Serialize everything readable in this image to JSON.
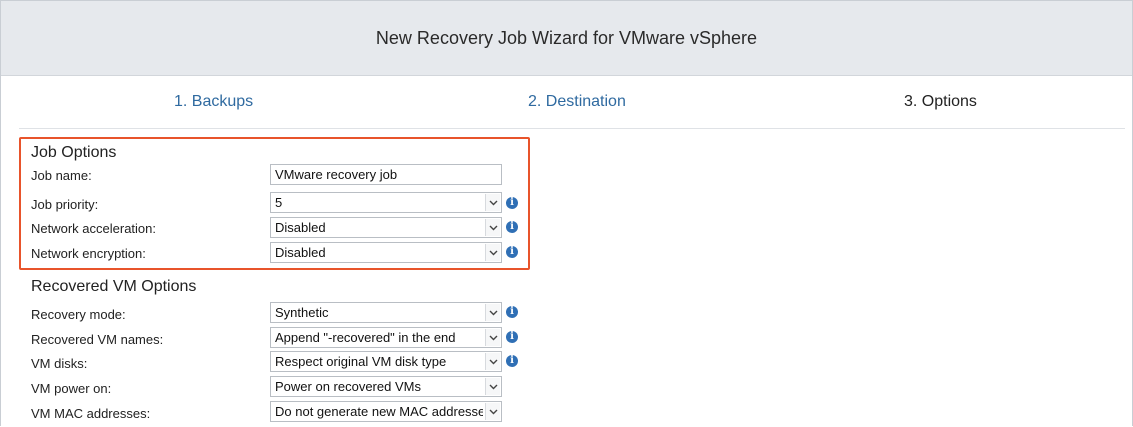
{
  "wizard": {
    "title": "New Recovery Job Wizard for VMware vSphere",
    "steps": [
      {
        "label": "1. Backups",
        "state": "link"
      },
      {
        "label": "2. Destination",
        "state": "link"
      },
      {
        "label": "3. Options",
        "state": "current"
      }
    ]
  },
  "job_options": {
    "heading": "Job Options",
    "rows": [
      {
        "label": "Job name:",
        "value": "VMware recovery job",
        "type": "text"
      },
      {
        "label": "Job priority:",
        "value": "5",
        "type": "select",
        "info": true
      },
      {
        "label": "Network acceleration:",
        "value": "Disabled",
        "type": "select",
        "info": true
      },
      {
        "label": "Network encryption:",
        "value": "Disabled",
        "type": "select",
        "info": true
      }
    ]
  },
  "vm_options": {
    "heading": "Recovered VM Options",
    "rows": [
      {
        "label": "Recovery mode:",
        "value": "Synthetic",
        "type": "select",
        "info": true
      },
      {
        "label": "Recovered VM names:",
        "value": "Append \"-recovered\" in the end",
        "type": "select",
        "info": true
      },
      {
        "label": "VM disks:",
        "value": "Respect original VM disk type",
        "type": "select",
        "info": true
      },
      {
        "label": "VM power on:",
        "value": "Power on recovered VMs",
        "type": "select",
        "info": false
      },
      {
        "label": "VM MAC addresses:",
        "value": "Do not generate new MAC addresses",
        "type": "select",
        "info": false
      }
    ]
  },
  "colors": {
    "highlight_border": "#e8542b",
    "link": "#2f6aa0",
    "info_icon": "#2f6fb5",
    "title_bar": "#e6e9ed"
  },
  "icons": {
    "info": "info-icon",
    "dropdown": "chevron-down-icon"
  }
}
